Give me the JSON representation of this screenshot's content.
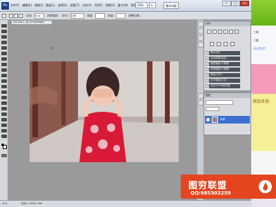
{
  "menubar": {
    "logo": "Ps",
    "items": [
      "文件(F)",
      "编辑(E)",
      "图像(I)",
      "图层(L)",
      "选择(S)",
      "滤镜(T)",
      "分析(A)",
      "3D(D)",
      "视图(V)",
      "窗口(W)",
      "帮助(H)"
    ],
    "zoom": "25%",
    "basic_button": "基本功能",
    "window_controls": [
      "—",
      "□",
      "×"
    ]
  },
  "options_bar": {
    "labels": [
      "羽化:",
      "0 px",
      "消除锯齿",
      "样式:",
      "正常",
      "宽度:",
      "高度:",
      "调整边缘..."
    ]
  },
  "document": {
    "tab_title": "2014041...@ 25%(RGB/8)"
  },
  "panels": {
    "actions_title": "动作",
    "action_buttons": [
      "默认动作",
      "淡出效果(选区)",
      "画框通道-50像素",
      "木质画框-50像素",
      "投影(文字)",
      "水中倒影(文字)",
      "自定义RGB到灰度",
      "熔化的铅块",
      "制作剪贴路径(选区)"
    ],
    "layers_title": "图层",
    "layer_name": "背景"
  },
  "status": {
    "zoom": "25%",
    "doc": "文档:5.49M/5.49M"
  },
  "side_app": {
    "lines": [
      "三联",
      "三群",
      "22:45:07",
      "添加多张"
    ]
  },
  "watermark": {
    "title": "图穷联盟",
    "qq": "QQ:985303259"
  },
  "colors": {
    "accent": "#e4451f",
    "panel_button": "#4d5259",
    "selection": "#3a6fd0"
  }
}
